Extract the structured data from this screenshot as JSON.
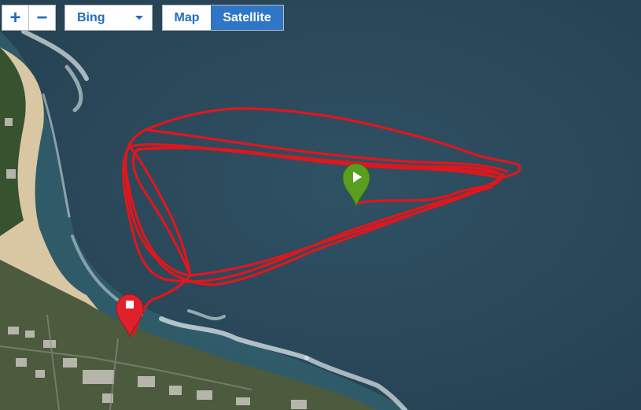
{
  "controls": {
    "zoom_in": "+",
    "zoom_out": "−",
    "provider": "Bing",
    "map_tab": "Map",
    "satellite_tab": "Satellite",
    "active_tab": "Satellite"
  },
  "markers": {
    "start": {
      "icon": "play-icon",
      "color": "#5a9e1f"
    },
    "end": {
      "icon": "stop-icon",
      "color": "#e0212b"
    }
  },
  "track": {
    "color": "#e0161d"
  },
  "colors": {
    "accent": "#1f6dc1",
    "active_tab": "#2f76c7",
    "ocean": "#2b4a5c"
  }
}
